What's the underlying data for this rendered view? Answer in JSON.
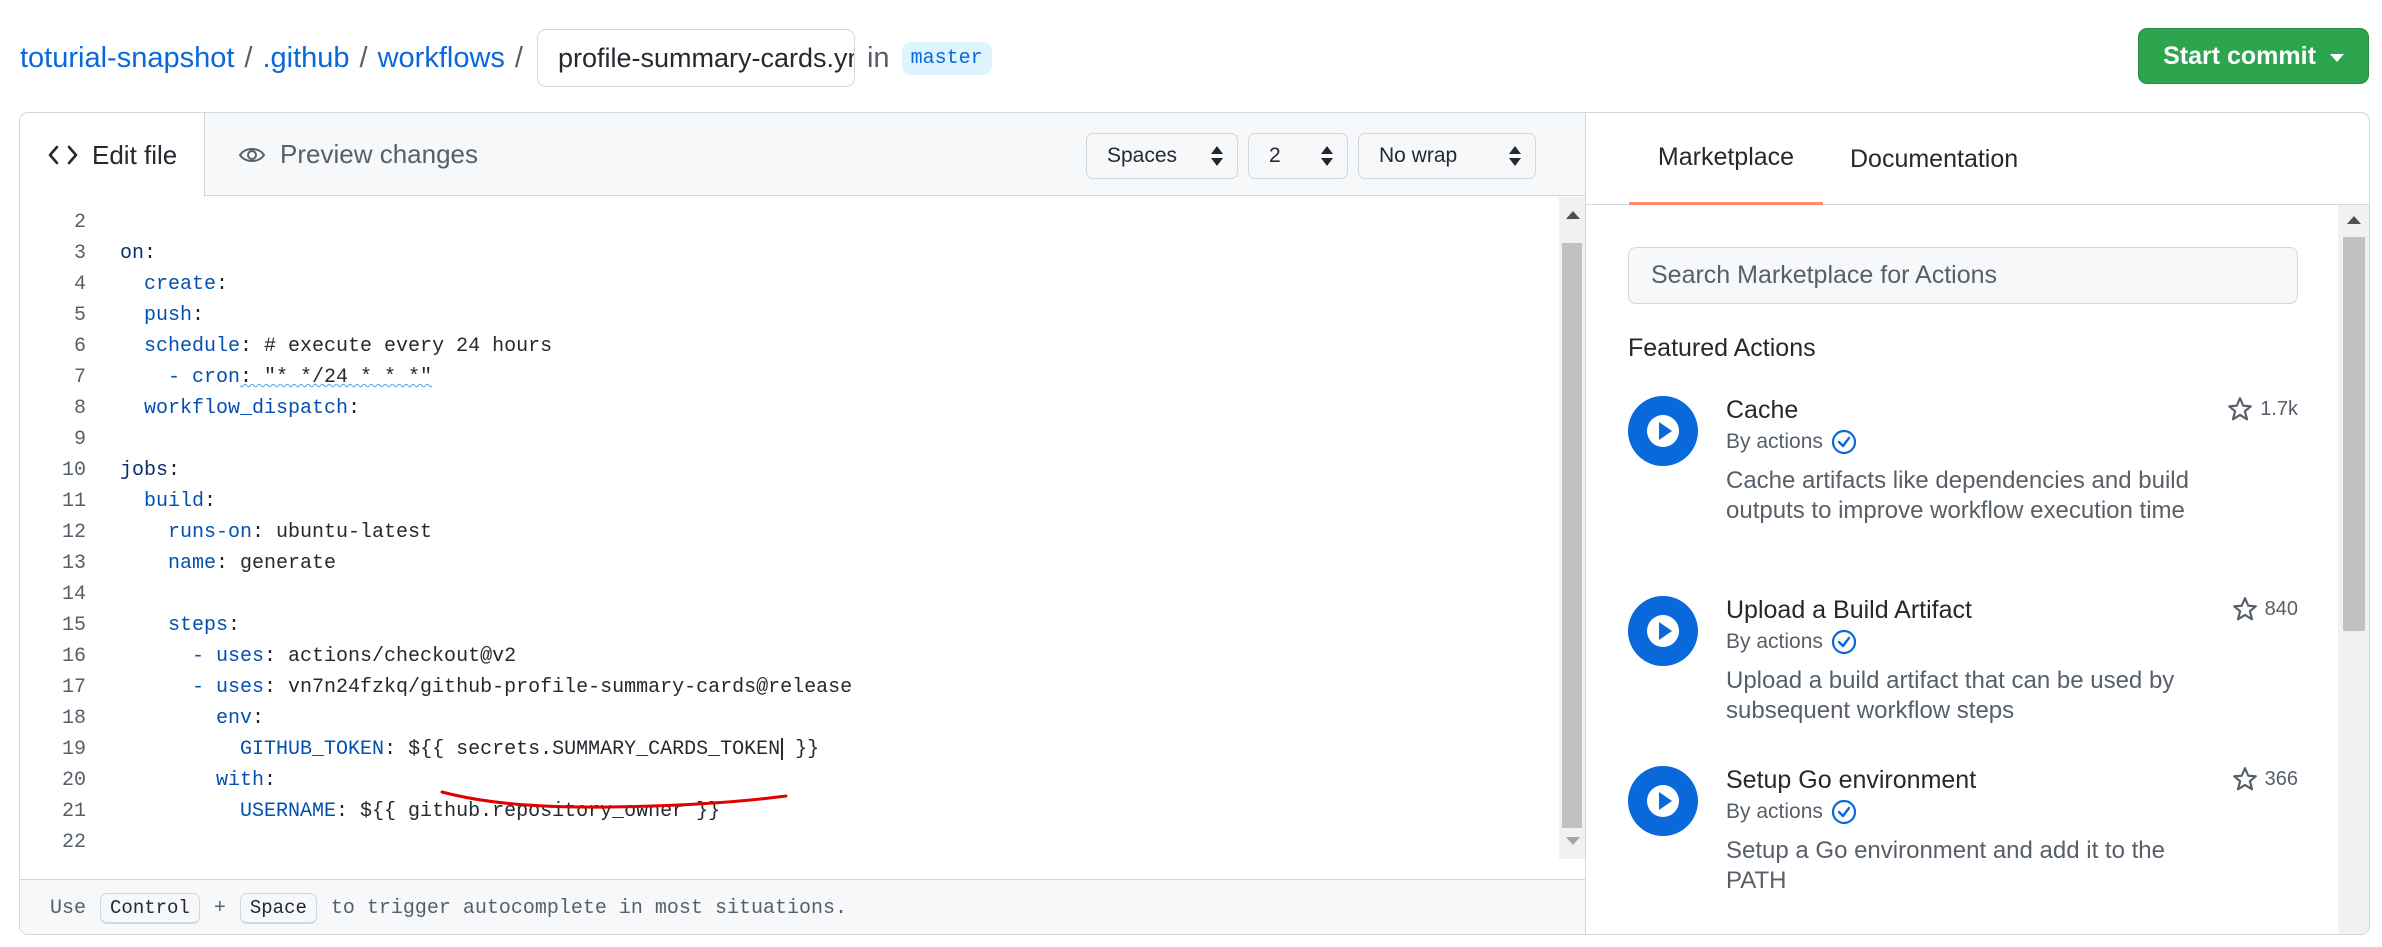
{
  "breadcrumb": {
    "repo": "toturial-snapshot",
    "folder1": ".github",
    "folder2": "workflows",
    "separator": "/",
    "filename": "profile-summary-cards.yml",
    "in_text": "in",
    "branch": "master"
  },
  "commit_button": {
    "label": "Start commit",
    "color": "#2da44e"
  },
  "editor": {
    "tabs": {
      "edit": "Edit file",
      "preview": "Preview changes"
    },
    "indent_mode": "Spaces",
    "indent_size": "2",
    "wrap_mode": "No wrap",
    "lines": [
      {
        "n": "2",
        "text": ""
      },
      {
        "n": "3",
        "key": "on",
        "text": ":"
      },
      {
        "n": "4",
        "indent": "  ",
        "key": "create",
        "text": ":"
      },
      {
        "n": "5",
        "indent": "  ",
        "key": "push",
        "text": ":"
      },
      {
        "n": "6",
        "indent": "  ",
        "key": "schedule",
        "text": ": # execute every 24 hours"
      },
      {
        "n": "7",
        "indent": "    ",
        "key": "- cron",
        "text": ": \"* */24 * * *\""
      },
      {
        "n": "8",
        "indent": "  ",
        "key": "workflow_dispatch",
        "text": ":"
      },
      {
        "n": "9",
        "text": ""
      },
      {
        "n": "10",
        "key": "jobs",
        "text": ":"
      },
      {
        "n": "11",
        "indent": "  ",
        "key": "build",
        "text": ":"
      },
      {
        "n": "12",
        "indent": "    ",
        "key": "runs-on",
        "text": ": ubuntu-latest"
      },
      {
        "n": "13",
        "indent": "    ",
        "key": "name",
        "text": ": generate"
      },
      {
        "n": "14",
        "text": ""
      },
      {
        "n": "15",
        "indent": "    ",
        "key": "steps",
        "text": ":"
      },
      {
        "n": "16",
        "indent": "      ",
        "key": "- uses",
        "text": ": actions/checkout@v2"
      },
      {
        "n": "17",
        "indent": "      ",
        "key": "- uses",
        "text": ": vn7n24fzkq/github-profile-summary-cards@release"
      },
      {
        "n": "18",
        "indent": "        ",
        "key": "env",
        "text": ":"
      },
      {
        "n": "19",
        "indent": "          ",
        "key": "GITHUB_TOKEN",
        "text": ": ${{ secrets.SUMMARY_CARDS_TOKEN }}"
      },
      {
        "n": "20",
        "indent": "        ",
        "key": "with",
        "text": ":"
      },
      {
        "n": "21",
        "indent": "          ",
        "key": "USERNAME",
        "text": ": ${{ github.repository_owner }}"
      },
      {
        "n": "22",
        "text": ""
      }
    ],
    "footer": {
      "prefix": "Use",
      "key1": "Control",
      "plus": "+",
      "key2": "Space",
      "suffix": "to trigger autocomplete in most situations."
    },
    "annotation_color": "#e00000"
  },
  "marketplace": {
    "tabs": [
      "Marketplace",
      "Documentation"
    ],
    "search_placeholder": "Search Marketplace for Actions",
    "featured_heading": "Featured Actions",
    "actions": [
      {
        "title": "Cache",
        "by": "By actions",
        "description": "Cache artifacts like dependencies and build outputs to improve workflow execution time",
        "stars": "1.7k"
      },
      {
        "title": "Upload a Build Artifact",
        "by": "By actions",
        "description": "Upload a build artifact that can be used by subsequent workflow steps",
        "stars": "840"
      },
      {
        "title": "Setup Go environment",
        "by": "By actions",
        "description": "Setup a Go environment and add it to the PATH",
        "stars": "366"
      }
    ],
    "accent_color": "#0969da"
  }
}
